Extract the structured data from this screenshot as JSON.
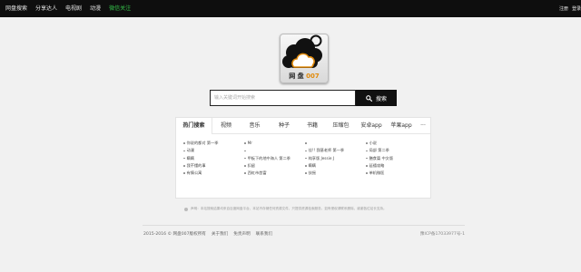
{
  "topnav": {
    "items": [
      "网盘搜索",
      "分享达人",
      "电视剧",
      "动漫",
      "微信关注"
    ],
    "right": [
      "注册",
      "登录"
    ]
  },
  "logo": {
    "text": "网 盘",
    "num": "007"
  },
  "search": {
    "placeholder": "输入关键词开始搜索",
    "button": "搜索"
  },
  "tabs": [
    "热门搜索",
    "视频",
    "音乐",
    "种子",
    "书籍",
    "压缩包",
    "安卓app",
    "苹果app",
    "···"
  ],
  "hot": {
    "col1": [
      "你说的都对 第一季",
      "动漫",
      "瞒瞒",
      "我不懂的事",
      "有情公寓"
    ],
    "col2": [
      "Mr",
      "",
      "甲板下的地中海人 第二季",
      "扣留",
      "西虹市首富"
    ],
    "col3": [
      "",
      "佳!! 我基老师 第一季",
      "纯享版 Jessie J",
      "瞒瞒",
      "扶摇"
    ],
    "col4": [
      "小说",
      "局部 第二季",
      "膳食篇 中文版",
      "延禧攻略",
      "单机微医"
    ]
  },
  "notice": "声明：本站搜索结果均来自百度网盘平台，本站不存储任何资源文件，只提供资源检索服务，如有侵权请联系删除，谢谢各位站长支持。",
  "footer": {
    "copyright": "2015-2016 © 网盘007版权所有",
    "links": [
      "关于我们",
      "免责声明",
      "联系我们"
    ],
    "icp": "豫ICP备17033977号-1"
  },
  "colors": {
    "topbar": "#0e0e0e",
    "accent_green": "#35c24a",
    "logo_orange": "#e18a0a"
  }
}
